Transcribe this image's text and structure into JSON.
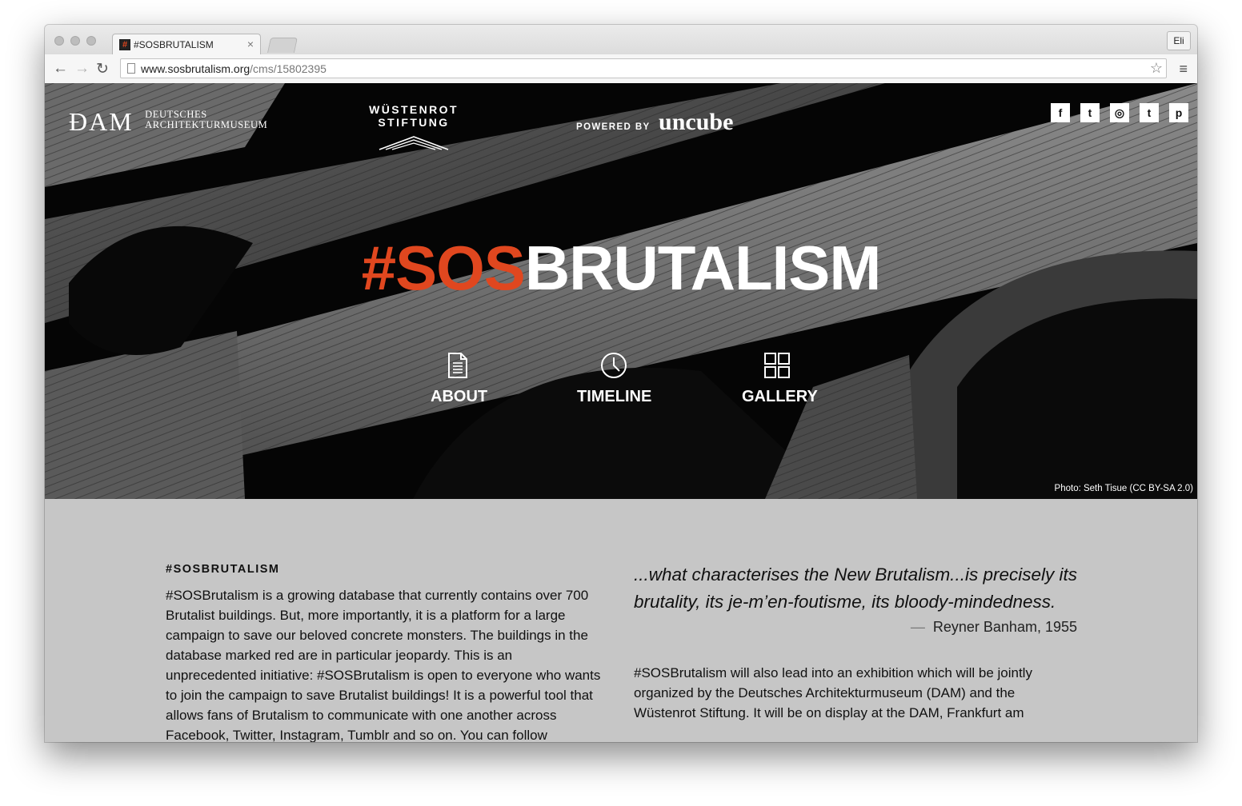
{
  "browser": {
    "tab_title": "#SOSBRUTALISM",
    "tab_close": "×",
    "profile_label": "Eli",
    "url_domain": "www.sosbrutalism.org",
    "url_path": "/cms/15802395",
    "back_icon": "←",
    "forward_icon": "→",
    "reload_icon": "↻",
    "star_icon": "☆",
    "menu_icon": "≡",
    "favicon_glyph": "#"
  },
  "header": {
    "dam_mark": "ĐAM",
    "dam_line1": "DEUTSCHES",
    "dam_line2": "ARCHITEKTURMUSEUM",
    "wuestenrot": "WÜSTENROT STIFTUNG",
    "powered_by": "POWERED BY",
    "uncube": "uncube",
    "social": [
      {
        "icon": "facebook-icon",
        "glyph": "f"
      },
      {
        "icon": "twitter-icon",
        "glyph": "t"
      },
      {
        "icon": "instagram-icon",
        "glyph": "◎"
      },
      {
        "icon": "tumblr-icon",
        "glyph": "t"
      },
      {
        "icon": "pinterest-icon",
        "glyph": "p"
      }
    ]
  },
  "hero": {
    "title_hash": "#",
    "title_sos": "SOS",
    "title_rest": "BRUTALISM",
    "nav": [
      {
        "label": "ABOUT",
        "icon": "document-icon"
      },
      {
        "label": "TIMELINE",
        "icon": "clock-icon"
      },
      {
        "label": "GALLERY",
        "icon": "grid-icon"
      }
    ],
    "photo_credit": "Photo: Seth Tisue (CC BY-SA 2.0)"
  },
  "intro": {
    "heading": "#SOSBRUTALISM",
    "body": "#SOSBrutalism is a growing database that currently contains over 700 Brutalist buildings. But, more importantly, it is a platform for a large campaign to save our beloved concrete monsters. The buildings in the database marked red are in particular jeopardy. This is an unprecedented initiative: #SOSBrutalism is open to everyone who wants to join the campaign to save Brutalist buildings! It is a powerful tool that allows fans of Brutalism to communicate with one another across Facebook, Twitter, Instagram, Tumblr and so on. You can follow"
  },
  "quote": {
    "text": "...what characterises the New Brutalism...is precisely its brutality, its je-m’en-foutisme, its bloody-mindedness.",
    "dash": "—",
    "author": "Reyner Banham, 1955"
  },
  "exhibition": {
    "body": "#SOSBrutalism will also lead into an exhibition which will be jointly organized by the Deutsches Architekturmuseum (DAM) and the Wüstenrot Stiftung. It will be on display at the DAM, Frankfurt am"
  },
  "colors": {
    "accent": "#e0471f",
    "content_bg": "#c6c6c6",
    "hero_bg": "#050505"
  }
}
